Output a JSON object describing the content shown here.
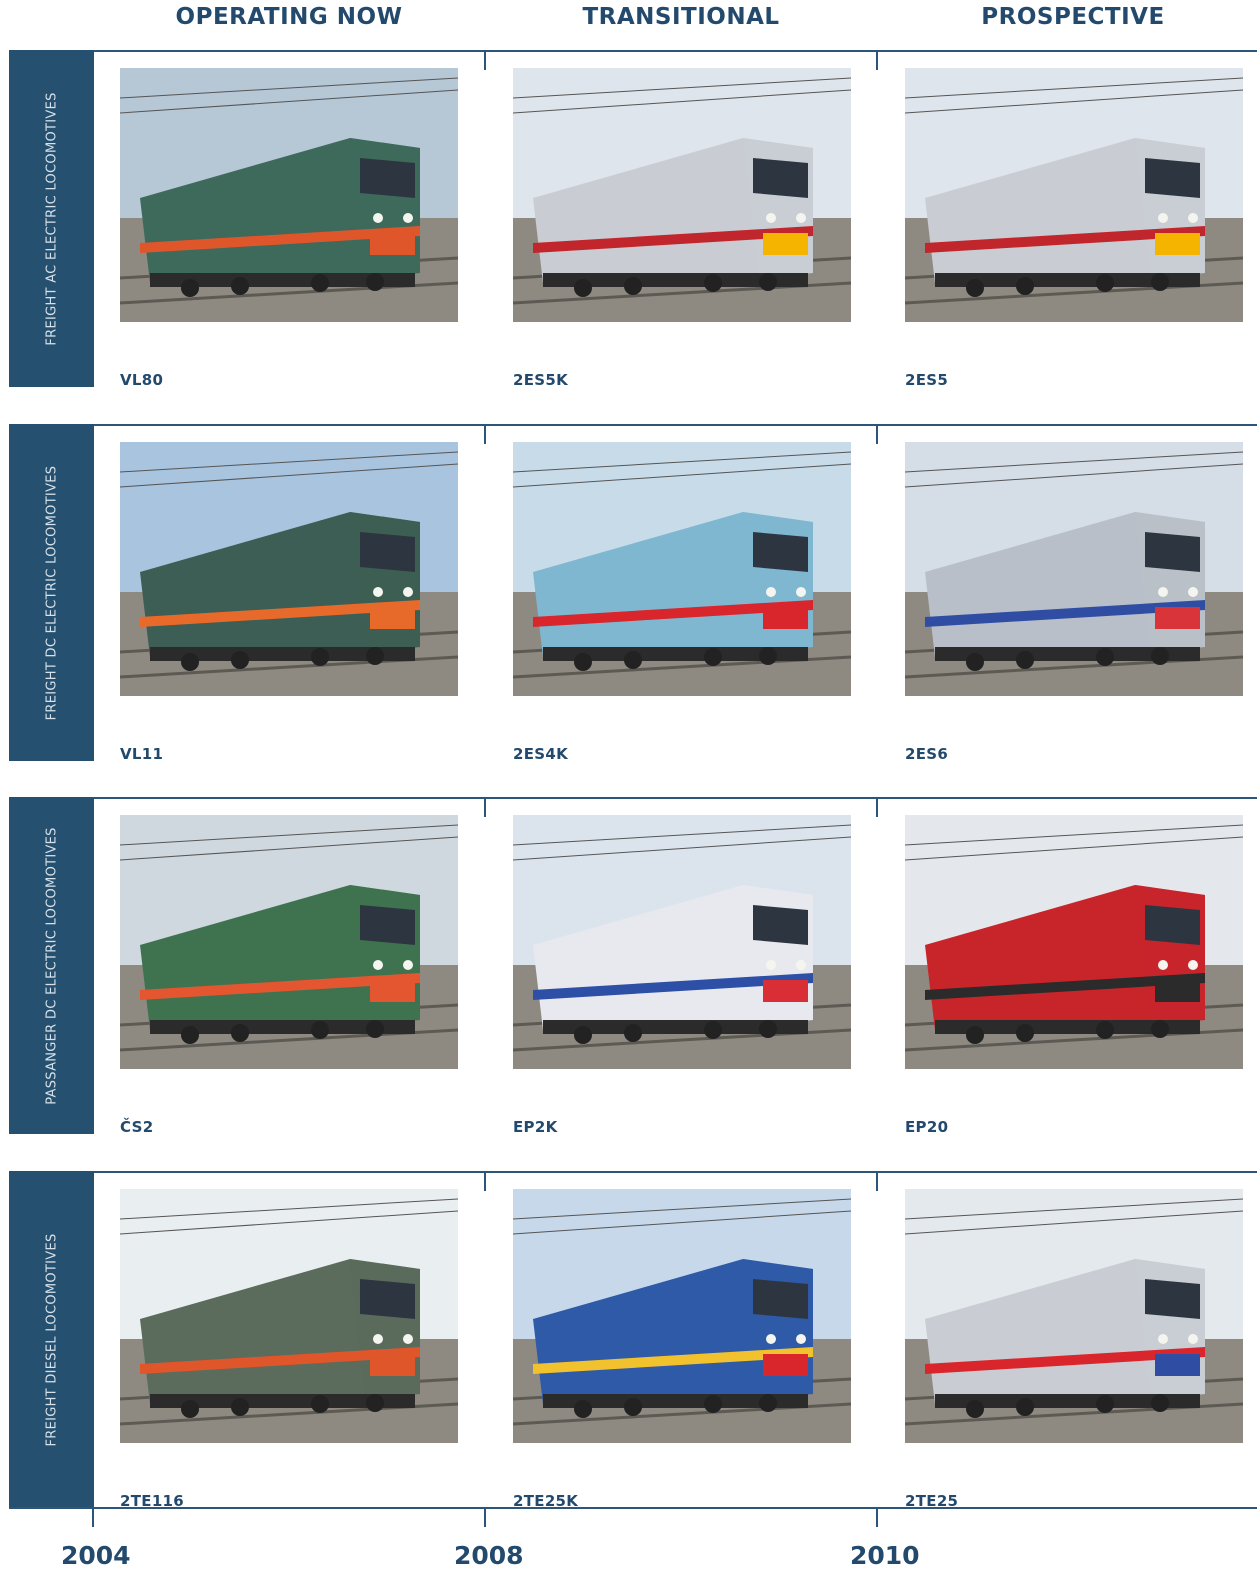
{
  "columns": [
    "OPERATING NOW",
    "TRANSITIONAL",
    "PROSPECTIVE"
  ],
  "rows": [
    {
      "label": "FREIGHT AC ELECTRIC LOCOMOTIVES",
      "models": [
        "VL80",
        "2ES5K",
        "2ES5"
      ],
      "colors": [
        {
          "body": "#3e6a5c",
          "stripe": "#e0562b",
          "sky": "#b6c7d6"
        },
        {
          "body": "#c9ccd3",
          "stripe": "#c0262c",
          "sky": "#dfe5ec",
          "front": "#f4b400"
        },
        {
          "body": "#c9ccd3",
          "stripe": "#c0262c",
          "sky": "#dfe5ec",
          "front": "#f4b400"
        }
      ]
    },
    {
      "label": "FREIGHT DC ELECTRIC LOCOMOTIVES",
      "models": [
        "VL11",
        "2ES4K",
        "2ES6"
      ],
      "colors": [
        {
          "body": "#3d5e54",
          "stripe": "#e86a2b",
          "sky": "#a9c4de"
        },
        {
          "body": "#7fb7d0",
          "stripe": "#d8262c",
          "sky": "#c8dbe9"
        },
        {
          "body": "#b9bfc8",
          "stripe": "#2f4ea3",
          "sky": "#d5dde6",
          "front": "#d8343a"
        }
      ]
    },
    {
      "label": "PASSANGER DC ELECTRIC LOCOMOTIVES",
      "models": [
        "ČS2",
        "EP2K",
        "EP20"
      ],
      "colors": [
        {
          "body": "#3f7350",
          "stripe": "#e3562f",
          "sky": "#cfd8df"
        },
        {
          "body": "#e8e9ee",
          "stripe": "#2e4fa6",
          "sky": "#dbe4ec",
          "front": "#d92e36"
        },
        {
          "body": "#c8252b",
          "stripe": "#2b2b2b",
          "sky": "#e4e8ec"
        }
      ]
    },
    {
      "label": "FREIGHT DIESEL LOCOMOTIVES",
      "models": [
        "2TE116",
        "2TE25K",
        "2TE25"
      ],
      "colors": [
        {
          "body": "#5b6b5c",
          "stripe": "#e0562b",
          "sky": "#e9eef1"
        },
        {
          "body": "#2e5aa8",
          "stripe": "#f2c12e",
          "sky": "#c6d8ea",
          "front": "#d8262c"
        },
        {
          "body": "#c9ccd3",
          "stripe": "#d8262c",
          "sky": "#e4e9ee",
          "front": "#2f4ea3"
        }
      ]
    }
  ],
  "years": [
    "2004",
    "2008",
    "2010"
  ]
}
